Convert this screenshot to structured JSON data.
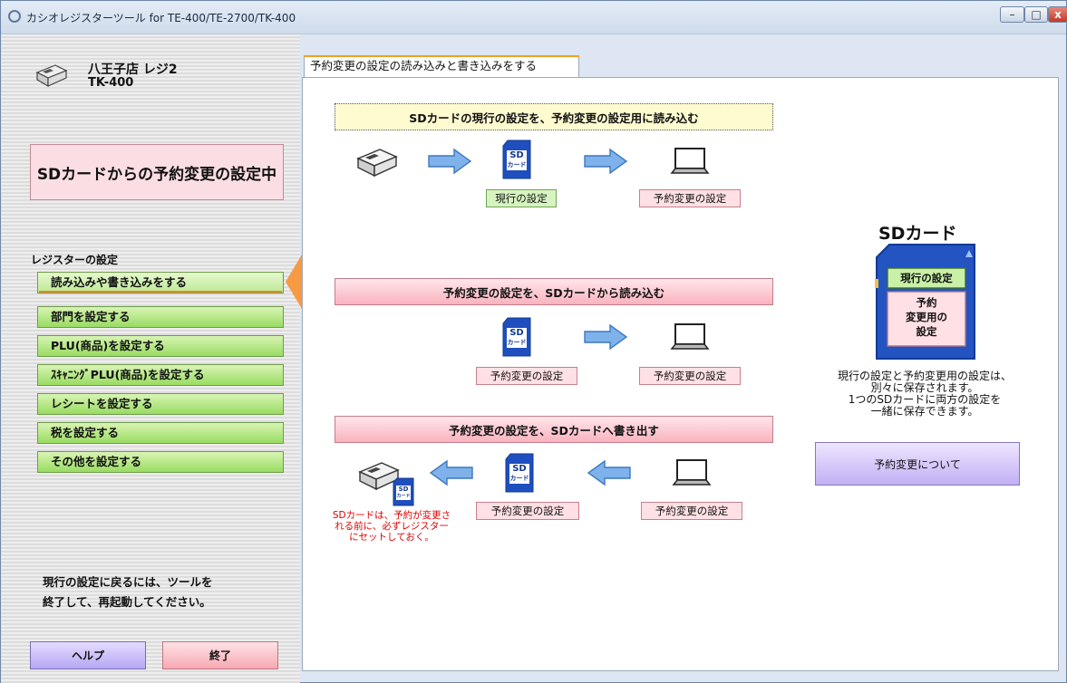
{
  "window": {
    "title": "カシオレジスターツール for TE-400/TE-2700/TK-400",
    "min_label": "–",
    "max_label": "□",
    "close_label": "x"
  },
  "sidebar": {
    "store": "八王子店 レジ2",
    "model": "TK-400",
    "status": "SDカードからの予約変更の設定中",
    "section_heading": "レジスターの設定",
    "items": [
      {
        "label": "読み込みや書き込みをする",
        "active": true
      },
      {
        "label": "部門を設定する"
      },
      {
        "label": "PLU(商品)を設定する"
      },
      {
        "label": "ｽｷｬﾆﾝｸﾞPLU(商品)を設定する"
      },
      {
        "label": "レシートを設定する"
      },
      {
        "label": "税を設定する"
      },
      {
        "label": "その他を設定する"
      }
    ],
    "footer_line1": "現行の設定に戻るには、ツールを",
    "footer_line2": "終了して、再起動してください。",
    "help_label": "ヘルプ",
    "exit_label": "終了"
  },
  "main": {
    "tab_label": "予約変更の設定の読み込みと書き込みをする",
    "section1": {
      "title": "SDカードの現行の設定を、予約変更の設定用に読み込む",
      "label_current": "現行の設定",
      "label_reserve": "予約変更の設定"
    },
    "section2": {
      "title": "予約変更の設定を、SDカードから読み込む",
      "label_sd": "予約変更の設定",
      "label_pc": "予約変更の設定"
    },
    "section3": {
      "title": "予約変更の設定を、SDカードへ書き出す",
      "label_sd": "予約変更の設定",
      "label_pc": "予約変更の設定",
      "note": "SDカードは、予約が変更される前に、必ずレジスターにセットしておく。"
    },
    "sd_icon_text_1": "SD",
    "sd_icon_text_2": "カード",
    "info": {
      "sd_title": "SDカード",
      "card_current": "現行の設定",
      "card_reserve_1": "予約",
      "card_reserve_2": "変更用の",
      "card_reserve_3": "設定",
      "desc_1": "現行の設定と予約変更用の設定は、",
      "desc_2": "別々に保存されます。",
      "desc_3": "1つのSDカードに両方の設定を",
      "desc_4": "一緒に保存できます。",
      "about_label": "予約変更について"
    }
  }
}
